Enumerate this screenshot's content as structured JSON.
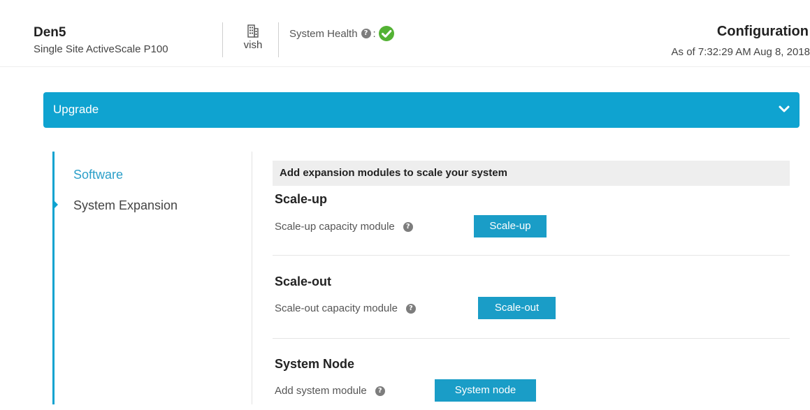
{
  "header": {
    "site_name": "Den5",
    "site_subtitle": "Single Site ActiveScale P100",
    "user_icon": "building-icon",
    "user_name": "vish",
    "health_label": "System Health",
    "health_colon": ":",
    "health_status_icon": "check-circle-icon",
    "health_status_color": "#53b234",
    "page_title": "Configuration",
    "as_of": "As of 7:32:29 AM Aug 8, 2018"
  },
  "upgrade": {
    "title": "Upgrade",
    "accent_color": "#0fa3d0",
    "chevron_icon": "chevron-down-icon"
  },
  "sidebar": {
    "items": [
      {
        "label": "Software",
        "active": true
      },
      {
        "label": "System Expansion",
        "active": false
      }
    ]
  },
  "content": {
    "banner": "Add expansion modules to scale your system",
    "sections": [
      {
        "title": "Scale-up",
        "label": "Scale-up capacity module",
        "button": "Scale-up"
      },
      {
        "title": "Scale-out",
        "label": "Scale-out capacity module",
        "button": "Scale-out"
      },
      {
        "title": "System Node",
        "label": "Add system module",
        "button": "System node"
      }
    ]
  },
  "help_icon_glyph": "?"
}
